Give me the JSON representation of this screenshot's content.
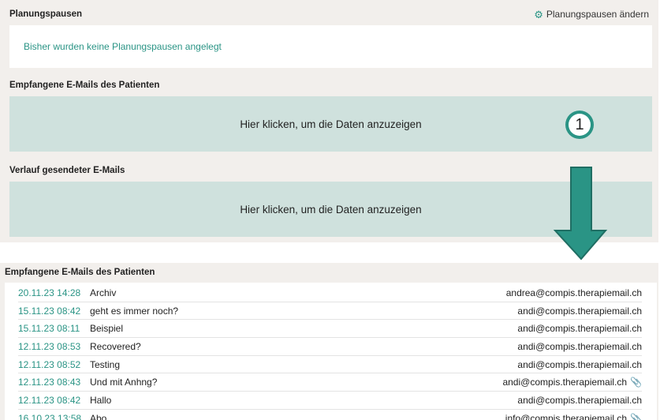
{
  "planning": {
    "title": "Planungspausen",
    "change_label": "Planungspausen ändern",
    "empty_text": "Bisher wurden keine Planungspausen angelegt"
  },
  "received": {
    "title": "Empfangene E-Mails des Patienten",
    "click_text": "Hier klicken, um die Daten anzuzeigen"
  },
  "sent": {
    "title": "Verlauf gesendeter E-Mails",
    "click_text": "Hier klicken, um die Daten anzuzeigen"
  },
  "marker": {
    "number": "1"
  },
  "colors": {
    "accent": "#2a9485",
    "panel": "#f2efec",
    "click_box": "#cfe1dd"
  },
  "expanded": {
    "title": "Empfangene E-Mails des Patienten",
    "emails": [
      {
        "date": "20.11.23 14:28",
        "subject": "Archiv",
        "from": "andrea@compis.therapiemail.ch",
        "attachment": false
      },
      {
        "date": "15.11.23 08:42",
        "subject": "geht es immer noch?",
        "from": "andi@compis.therapiemail.ch",
        "attachment": false
      },
      {
        "date": "15.11.23 08:11",
        "subject": "Beispiel",
        "from": "andi@compis.therapiemail.ch",
        "attachment": false
      },
      {
        "date": "12.11.23 08:53",
        "subject": "Recovered?",
        "from": "andi@compis.therapiemail.ch",
        "attachment": false
      },
      {
        "date": "12.11.23 08:52",
        "subject": "Testing",
        "from": "andi@compis.therapiemail.ch",
        "attachment": false
      },
      {
        "date": "12.11.23 08:43",
        "subject": "Und mit Anhng?",
        "from": "andi@compis.therapiemail.ch",
        "attachment": true
      },
      {
        "date": "12.11.23 08:42",
        "subject": "Hallo",
        "from": "andi@compis.therapiemail.ch",
        "attachment": false
      },
      {
        "date": "16.10.23 13:58",
        "subject": "Abo",
        "from": "info@compis.therapiemail.ch",
        "attachment": true
      }
    ]
  }
}
